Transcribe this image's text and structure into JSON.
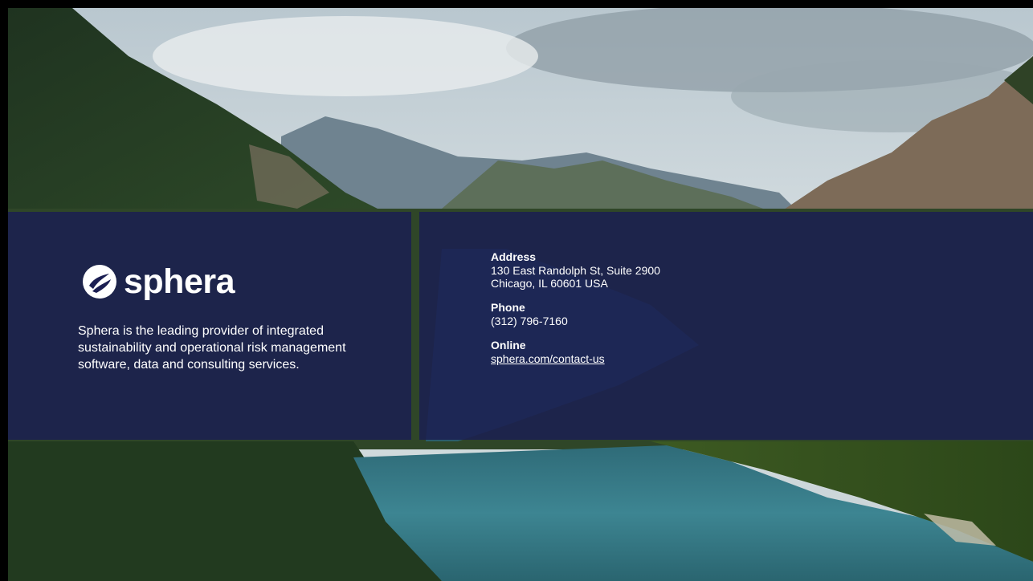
{
  "company": {
    "logo_word": "sphera",
    "description": "Sphera is the leading provider of integrated sustainability and operational risk management software, data and consulting services."
  },
  "contact": {
    "address_label": "Address",
    "address_line1": "130 East Randolph St, Suite 2900",
    "address_line2": "Chicago, IL 60601 USA",
    "phone_label": "Phone",
    "phone_value": "(312) 796-7160",
    "online_label": "Online",
    "online_link": "sphera.com/contact-us"
  },
  "colors": {
    "panel": "#1b1e52",
    "text": "#ffffff"
  },
  "icons": {
    "logo_mark": "sphera-logo-icon"
  }
}
